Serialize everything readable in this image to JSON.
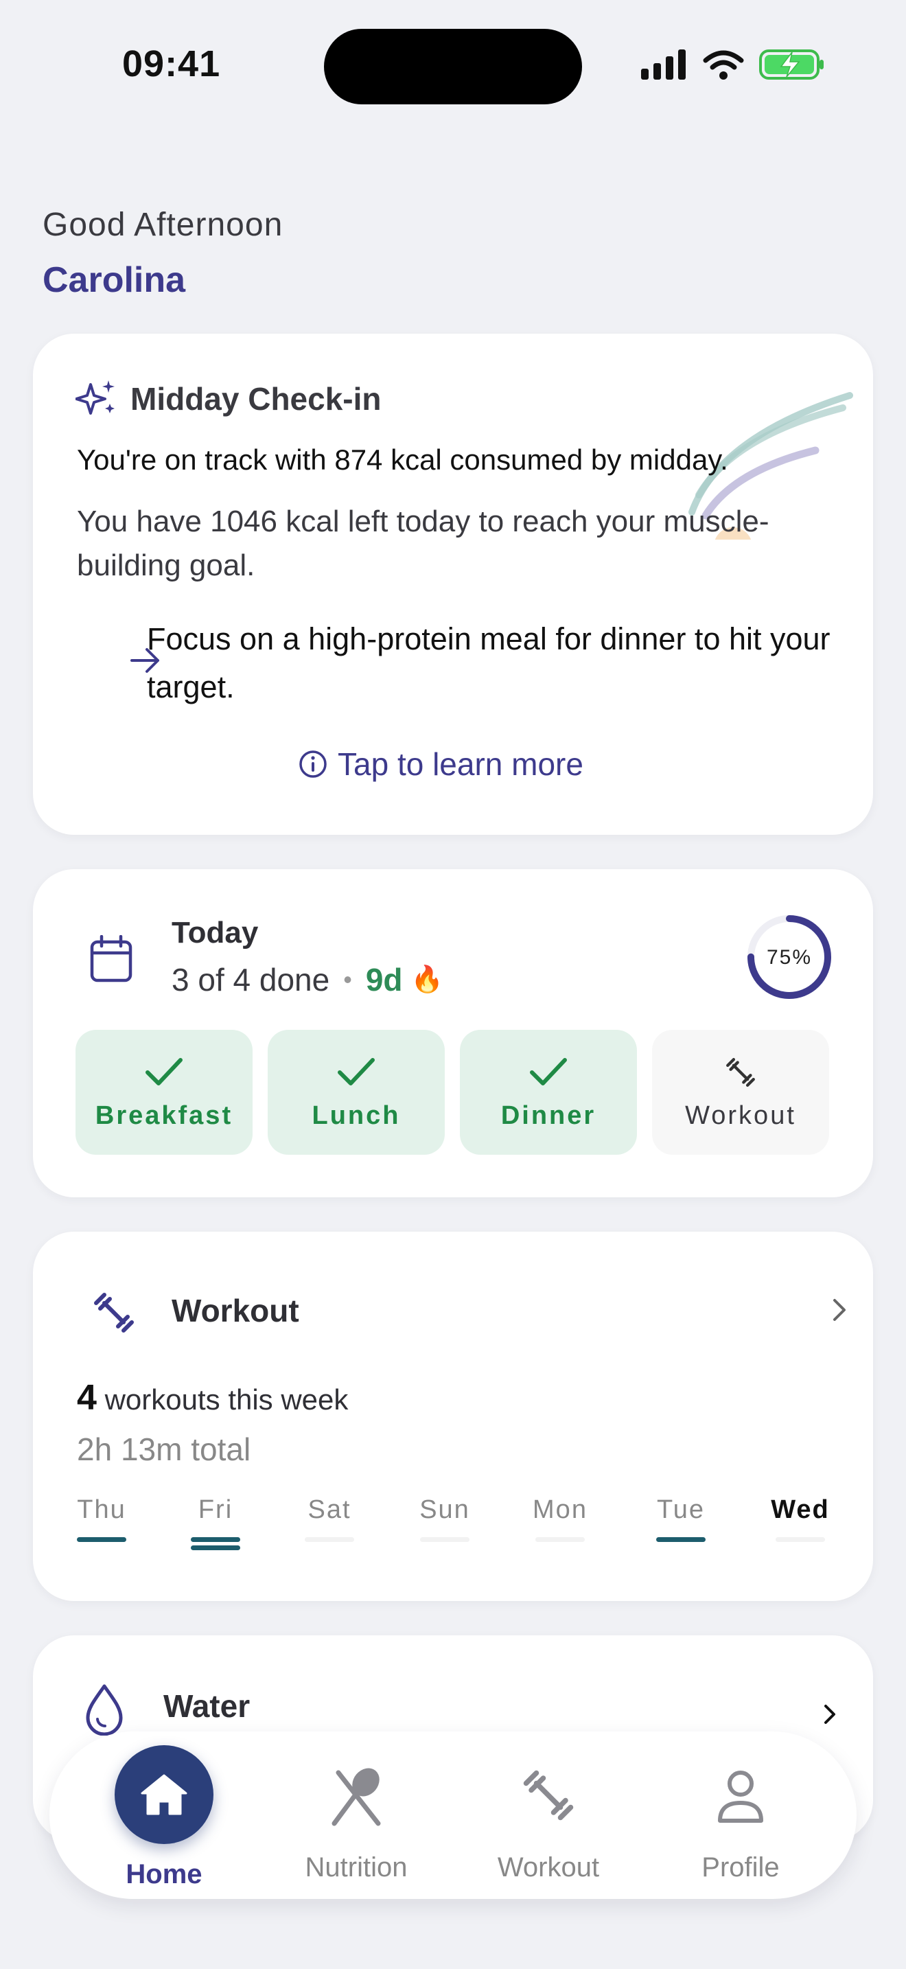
{
  "status": {
    "time": "09:41"
  },
  "greeting": {
    "salutation": "Good Afternoon",
    "name": "Carolina"
  },
  "checkin": {
    "title": "Midday Check-in",
    "line1": "You're on track with 874 kcal consumed by midday.",
    "line2": "You have 1046 kcal left today to reach your muscle-building goal.",
    "focus": "Focus on a high-protein meal for dinner to hit your target.",
    "learn_more": "Tap to learn more"
  },
  "today": {
    "title": "Today",
    "progress_text": "3 of 4 done",
    "separator": "•",
    "streak": "9d",
    "streak_emoji": "🔥",
    "percent_label": "75%",
    "percent": 0.75,
    "items": [
      {
        "label": "Breakfast",
        "done": true
      },
      {
        "label": "Lunch",
        "done": true
      },
      {
        "label": "Dinner",
        "done": true
      },
      {
        "label": "Workout",
        "done": false
      }
    ]
  },
  "workout": {
    "title": "Workout",
    "count": "4",
    "count_label": "workouts this week",
    "total": "2h 13m total",
    "days": [
      {
        "label": "Thu",
        "sessions": 1
      },
      {
        "label": "Fri",
        "sessions": 2
      },
      {
        "label": "Sat",
        "sessions": 0
      },
      {
        "label": "Sun",
        "sessions": 0
      },
      {
        "label": "Mon",
        "sessions": 0
      },
      {
        "label": "Tue",
        "sessions": 1
      },
      {
        "label": "Wed",
        "sessions": 0,
        "current": true
      }
    ]
  },
  "water": {
    "title": "Water"
  },
  "tabs": [
    {
      "label": "Home",
      "active": true
    },
    {
      "label": "Nutrition"
    },
    {
      "label": "Workout"
    },
    {
      "label": "Profile"
    }
  ],
  "colors": {
    "accent": "#3d3a8c",
    "success": "#1f8a45",
    "home_button": "#2b3f7a"
  }
}
